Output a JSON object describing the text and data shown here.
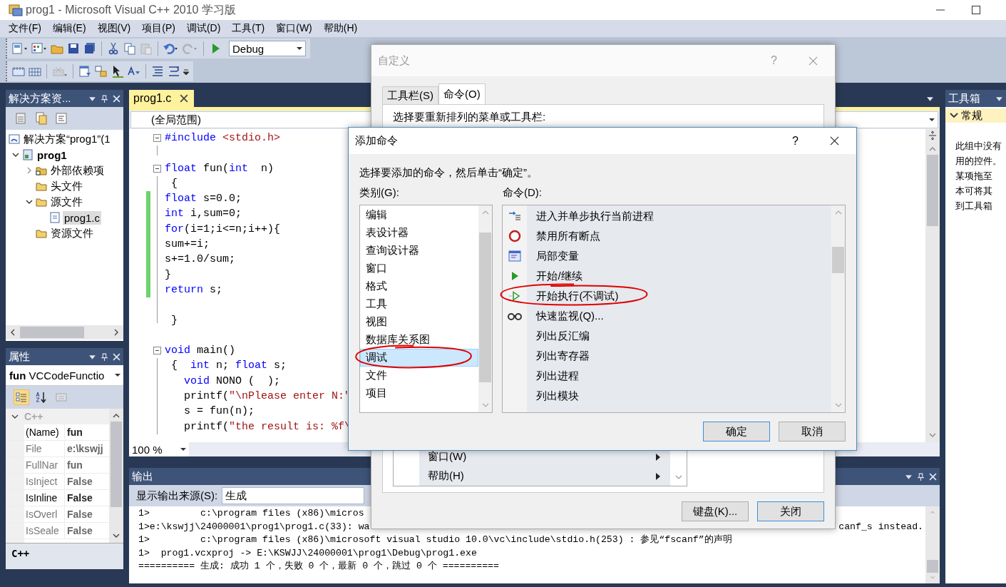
{
  "window": {
    "title": "prog1 - Microsoft Visual C++ 2010 学习版"
  },
  "menu": [
    "文件(F)",
    "编辑(E)",
    "视图(V)",
    "项目(P)",
    "调试(D)",
    "工具(T)",
    "窗口(W)",
    "帮助(H)"
  ],
  "toolbar": {
    "configuration": "Debug"
  },
  "solution_explorer": {
    "title": "解决方案资...",
    "tree": [
      {
        "label": "解决方案“prog1”(1",
        "kind": "solution",
        "selected": false,
        "children": [
          {
            "label": "prog1",
            "kind": "project",
            "expanded": true,
            "selected": false,
            "children": [
              {
                "label": "外部依赖项",
                "kind": "references",
                "expanded": false,
                "selected": false
              },
              {
                "label": "头文件",
                "kind": "folder",
                "selected": false
              },
              {
                "label": "源文件",
                "kind": "folder",
                "expanded": true,
                "selected": false,
                "children": [
                  {
                    "label": "prog1.c",
                    "kind": "file",
                    "selected": true
                  }
                ]
              },
              {
                "label": "资源文件",
                "kind": "folder",
                "selected": false
              }
            ]
          }
        ]
      }
    ]
  },
  "properties": {
    "title": "属性",
    "object": "**fun** VCCodeFunctio",
    "view_buttons": [
      {
        "selected": true,
        "disabled": false
      },
      {
        "selected": false,
        "disabled": false
      },
      {
        "selected": false,
        "disabled": true
      }
    ],
    "category": "C++",
    "category_expanded": true,
    "rows": [
      {
        "name": "(Name)",
        "value": "fun",
        "readonly": false
      },
      {
        "name": "File",
        "value": "e:\\kswjj",
        "readonly": true
      },
      {
        "name": "FullNar",
        "value": "fun",
        "readonly": true
      },
      {
        "name": "IsInject",
        "value": "False",
        "readonly": true
      },
      {
        "name": "IsInline",
        "value": "False",
        "readonly": false
      },
      {
        "name": "IsOverl",
        "value": "False",
        "readonly": true
      },
      {
        "name": "IsSeale",
        "value": "False",
        "readonly": true
      }
    ],
    "description": "C++"
  },
  "editor": {
    "tab": "prog1.c",
    "scope": "(全局范围)",
    "zoom": "100 %",
    "lines": [
      {
        "segments": [
          {
            "text": "#include",
            "kind": "keyword"
          },
          {
            "text": " <stdio.h>",
            "kind": "string"
          }
        ],
        "kind": "fold-start",
        "changed": false
      },
      {
        "kind": "fold-end",
        "changed": false
      },
      {
        "segments": [
          {
            "text": "float",
            "kind": "keyword"
          },
          {
            "text": " fun(",
            "kind": "plain"
          },
          {
            "text": "int",
            "kind": "keyword"
          },
          {
            "text": "  n)",
            "kind": "plain"
          }
        ],
        "kind": "fold-start",
        "changed": false
      },
      {
        "segments": [
          {
            "text": " {",
            "kind": "plain"
          }
        ],
        "kind": "fold-inner",
        "changed": false
      },
      {
        "segments": [
          {
            "text": "float",
            "kind": "keyword"
          },
          {
            "text": " s=0.0;",
            "kind": "plain"
          }
        ],
        "kind": "fold-inner",
        "changed": true
      },
      {
        "segments": [
          {
            "text": "int",
            "kind": "keyword"
          },
          {
            "text": " i,sum=0;",
            "kind": "plain"
          }
        ],
        "kind": "fold-inner",
        "changed": true
      },
      {
        "segments": [
          {
            "text": "for",
            "kind": "keyword"
          },
          {
            "text": "(i=1;i<=n;i++){",
            "kind": "plain"
          }
        ],
        "kind": "fold-inner",
        "changed": true
      },
      {
        "segments": [
          {
            "text": "sum+=i;",
            "kind": "plain"
          }
        ],
        "kind": "fold-inner",
        "changed": true
      },
      {
        "segments": [
          {
            "text": "s+=1.0/sum;",
            "kind": "plain"
          }
        ],
        "kind": "fold-inner",
        "changed": true
      },
      {
        "segments": [
          {
            "text": "}",
            "kind": "plain"
          }
        ],
        "kind": "fold-inner",
        "changed": true
      },
      {
        "segments": [
          {
            "text": "return",
            "kind": "keyword"
          },
          {
            "text": " s;",
            "kind": "plain"
          }
        ],
        "kind": "fold-inner",
        "changed": true
      },
      {
        "kind": "fold-inner",
        "changed": false
      },
      {
        "segments": [
          {
            "text": " }",
            "kind": "plain"
          }
        ],
        "kind": "fold-end",
        "changed": false
      },
      {
        "kind": "plain",
        "changed": false
      },
      {
        "segments": [
          {
            "text": "void",
            "kind": "keyword"
          },
          {
            "text": " main()",
            "kind": "plain"
          }
        ],
        "kind": "fold-start",
        "changed": false
      },
      {
        "segments": [
          {
            "text": " {  ",
            "kind": "plain"
          },
          {
            "text": "int",
            "kind": "keyword"
          },
          {
            "text": " n; ",
            "kind": "plain"
          },
          {
            "text": "float",
            "kind": "keyword"
          },
          {
            "text": " s;",
            "kind": "plain"
          }
        ],
        "kind": "fold-inner",
        "changed": false
      },
      {
        "segments": [
          {
            "text": "   void",
            "kind": "keyword"
          },
          {
            "text": " NONO (  );",
            "kind": "plain"
          }
        ],
        "kind": "fold-inner",
        "changed": false
      },
      {
        "segments": [
          {
            "text": "   printf(",
            "kind": "plain"
          },
          {
            "text": "\"\\nPlease enter N:\"",
            "kind": "string"
          }
        ],
        "kind": "fold-inner",
        "changed": false
      },
      {
        "segments": [
          {
            "text": "   s = fun(n);",
            "kind": "plain"
          }
        ],
        "kind": "fold-inner",
        "changed": false
      },
      {
        "segments": [
          {
            "text": "   printf(",
            "kind": "plain"
          },
          {
            "text": "\"the result is: %f\\",
            "kind": "string"
          }
        ],
        "kind": "fold-inner",
        "changed": false
      }
    ]
  },
  "output": {
    "title": "输出",
    "source_label": "显示输出来源(S):",
    "source": "生成",
    "lines": [
      {
        "text": "1>         c:\\program files (x86)\\micros"
      },
      {
        "text": "1>e:\\kswjj\\24000001\\prog1\\prog1.c(33): wa",
        "tail": "canf_s instead."
      },
      {
        "text": "1>         c:\\program files (x86)\\microsoft visual studio 10.0\\vc\\include\\stdio.h(253) : 参见“fscanf”的声明"
      },
      {
        "text": "1>  prog1.vcxproj -> E:\\KSWJJ\\24000001\\prog1\\Debug\\prog1.exe"
      },
      {
        "text": "========== 生成: 成功 1 个，失败 0 个，最新 0 个，跳过 0 个 =========="
      }
    ]
  },
  "toolbox": {
    "title": "工具箱",
    "group": "常规",
    "group_expanded": true,
    "message_lines": [
      "此组中没有",
      "用的控件。",
      "某项拖至",
      "本可将其",
      "到工具箱"
    ]
  },
  "customize_dialog": {
    "title": "自定义",
    "help_button": "?",
    "tabs": [
      {
        "label": "工具栏(S)",
        "selected": false
      },
      {
        "label": "命令(O)",
        "selected": true
      }
    ],
    "prompt": "选择要重新排列的菜单或工具栏:",
    "menu_items": [
      {
        "label": "窗口(W)"
      },
      {
        "label": "帮助(H)"
      }
    ],
    "buttons": [
      {
        "label": "键盘(K)...",
        "default": false
      },
      {
        "label": "关闭",
        "default": true
      }
    ]
  },
  "add_command_dialog": {
    "title": "添加命令",
    "help_button": "?",
    "prompt": "选择要添加的命令，然后单击“确定”。",
    "categories_label": "类别(G):",
    "commands_label": "命令(D):",
    "categories": [
      {
        "label": "编辑",
        "selected": false,
        "circled": false
      },
      {
        "label": "表设计器",
        "selected": false,
        "circled": false
      },
      {
        "label": "查询设计器",
        "selected": false,
        "circled": false
      },
      {
        "label": "窗口",
        "selected": false,
        "circled": false
      },
      {
        "label": "格式",
        "selected": false,
        "circled": false
      },
      {
        "label": "工具",
        "selected": false,
        "circled": false
      },
      {
        "label": "视图",
        "selected": false,
        "circled": false
      },
      {
        "label": "数据库关系图",
        "selected": false,
        "circled": false
      },
      {
        "label": "调试",
        "selected": true,
        "circled": true
      },
      {
        "label": "文件",
        "selected": false,
        "circled": false
      },
      {
        "label": "项目",
        "selected": false,
        "circled": false
      }
    ],
    "commands": [
      {
        "label": "进入并单步执行当前进程",
        "kind": "step",
        "circled": false
      },
      {
        "label": "禁用所有断点",
        "kind": "breakpoint",
        "circled": false
      },
      {
        "label": "局部变量",
        "kind": "locals",
        "circled": false
      },
      {
        "label": "开始/继续",
        "kind": "play",
        "circled": false
      },
      {
        "label": "开始执行(不调试)",
        "kind": "play-outline",
        "circled": true
      },
      {
        "label": "快速监视(Q)...",
        "kind": "glasses",
        "circled": false
      },
      {
        "label": "列出反汇编",
        "kind": "text",
        "circled": false
      },
      {
        "label": "列出寄存器",
        "kind": "text",
        "circled": false
      },
      {
        "label": "列出进程",
        "kind": "text",
        "circled": false
      },
      {
        "label": "列出模块",
        "kind": "text",
        "circled": false
      }
    ],
    "buttons": [
      {
        "label": "确定",
        "default": true
      },
      {
        "label": "取消",
        "default": false
      }
    ]
  }
}
